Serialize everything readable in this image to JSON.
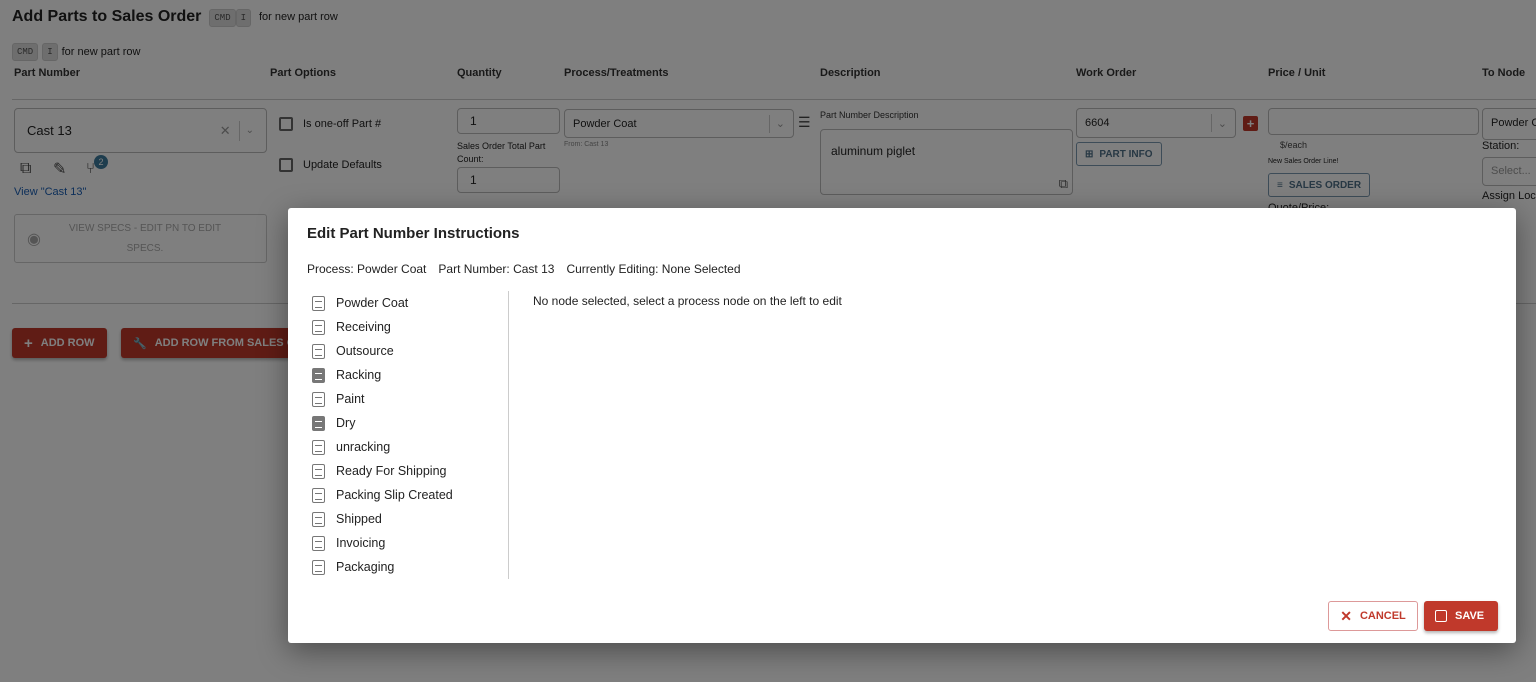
{
  "page": {
    "title": "Add Parts to Sales Order",
    "shortcut_keys": [
      "CMD",
      "I"
    ],
    "shortcut_text": "for new part row"
  },
  "columns": [
    "Part Number",
    "Part Options",
    "Quantity",
    "Process/Treatments",
    "Description",
    "Work Order",
    "Price / Unit",
    "To Node"
  ],
  "row": {
    "part_number": "Cast 13",
    "view_link": "View \"Cast 13\"",
    "revision_badge": "2",
    "view_specs": "VIEW SPECS - EDIT PN TO EDIT SPECS.",
    "options": [
      "Is one-off Part #",
      "Update Defaults"
    ],
    "quantity": "1",
    "total_label": "Sales Order Total Part Count:",
    "total_value": "1",
    "process": "Powder Coat",
    "process_from": "From: Cast 13",
    "description_label": "Part Number Description",
    "description": "aluminum piglet",
    "work_order": "6604",
    "part_info": "PART INFO",
    "price_value": "",
    "price_unit": "$/each",
    "new_line": "New Sales Order Line!",
    "sales_order": "SALES ORDER",
    "quote_label": "Quote/Price:",
    "to_node": "Powder Coat",
    "station_label": "Station:",
    "station_placeholder": "Select...",
    "assign_label": "Assign Loc"
  },
  "actions": {
    "add_row": "ADD ROW",
    "add_row_from": "ADD ROW FROM SALES O"
  },
  "modal": {
    "title": "Edit Part Number Instructions",
    "process": "Process: Powder Coat",
    "part_number": "Part Number: Cast 13",
    "editing": "Currently Editing: None Selected",
    "empty_message": "No node selected, select a process node on the left to edit",
    "nodes": [
      {
        "label": "Powder Coat",
        "icon": "document-outline"
      },
      {
        "label": "Receiving",
        "icon": "document-outline"
      },
      {
        "label": "Outsource",
        "icon": "document-outline"
      },
      {
        "label": "Racking",
        "icon": "document-filled"
      },
      {
        "label": "Paint",
        "icon": "document-outline"
      },
      {
        "label": "Dry",
        "icon": "document-filled"
      },
      {
        "label": "unracking",
        "icon": "document-outline"
      },
      {
        "label": "Ready For Shipping",
        "icon": "document-outline"
      },
      {
        "label": "Packing Slip Created",
        "icon": "document-outline"
      },
      {
        "label": "Shipped",
        "icon": "document-outline"
      },
      {
        "label": "Invoicing",
        "icon": "document-outline"
      },
      {
        "label": "Packaging",
        "icon": "document-outline"
      }
    ],
    "cancel": "CANCEL",
    "save": "SAVE"
  },
  "colors": {
    "accent": "#c0392b",
    "link": "#1a5fb4",
    "outline_button": "#4f7088",
    "overlay": "rgba(0,0,0,0.5)"
  }
}
